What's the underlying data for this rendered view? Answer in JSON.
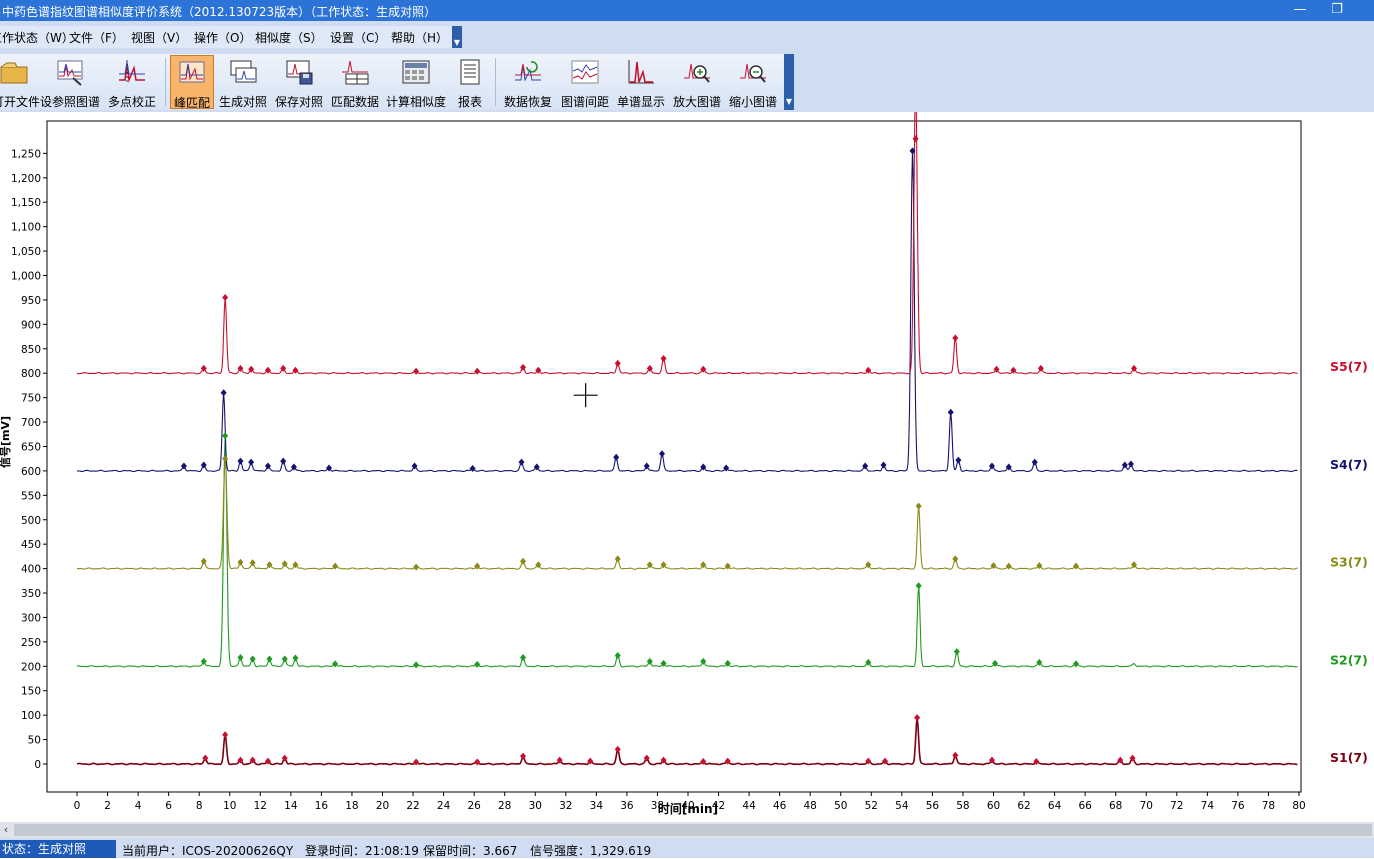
{
  "window": {
    "title": "中药色谱指纹图谱相似度评价系统（2012.130723版本）（工作状态：生成对照）"
  },
  "window_controls": {
    "minimize": "—",
    "restore": "❐"
  },
  "menu": [
    {
      "label": "工作状态（W）"
    },
    {
      "label": "文件（F）"
    },
    {
      "label": "视图（V）"
    },
    {
      "label": "操作（O）"
    },
    {
      "label": "相似度（S）"
    },
    {
      "label": "设置（C）"
    },
    {
      "label": "帮助（H）"
    }
  ],
  "toolbar": [
    {
      "label": "打开文件",
      "icon": "open-folder-icon"
    },
    {
      "label": "设参照图谱",
      "icon": "set-reference-icon"
    },
    {
      "label": "多点校正",
      "icon": "multipoint-correction-icon"
    },
    {
      "label": "峰匹配",
      "icon": "peak-match-icon",
      "active": true
    },
    {
      "label": "生成对照",
      "icon": "generate-reference-icon"
    },
    {
      "label": "保存对照",
      "icon": "save-reference-icon"
    },
    {
      "label": "匹配数据",
      "icon": "match-data-icon"
    },
    {
      "label": "计算相似度",
      "icon": "calculate-similarity-icon"
    },
    {
      "label": "报表",
      "icon": "report-icon"
    },
    {
      "label": "数据恢复",
      "icon": "data-restore-icon"
    },
    {
      "label": "图谱间距",
      "icon": "spectrum-spacing-icon"
    },
    {
      "label": "单谱显示",
      "icon": "single-spectrum-icon"
    },
    {
      "label": "放大图谱",
      "icon": "zoom-in-icon"
    },
    {
      "label": "缩小图谱",
      "icon": "zoom-out-icon"
    }
  ],
  "chart_data": {
    "type": "line",
    "xlabel": "时间[min]",
    "ylabel": "信号[mV]",
    "xlim": [
      0,
      80
    ],
    "ylim": [
      -15,
      1290
    ],
    "xticks": [
      0,
      2,
      4,
      6,
      8,
      10,
      12,
      14,
      16,
      18,
      20,
      22,
      24,
      26,
      28,
      30,
      32,
      34,
      36,
      38,
      40,
      42,
      44,
      46,
      48,
      50,
      52,
      54,
      56,
      58,
      60,
      62,
      64,
      66,
      68,
      70,
      72,
      74,
      76,
      78,
      80
    ],
    "yticks": [
      0,
      50,
      100,
      150,
      200,
      250,
      300,
      350,
      400,
      450,
      500,
      550,
      600,
      650,
      700,
      750,
      800,
      850,
      900,
      950,
      1000,
      1050,
      1100,
      1150,
      1200,
      1250
    ],
    "grid": false,
    "series": [
      {
        "name": "S1(7)",
        "color": "#7a0010",
        "marker_color": "#c8102e",
        "baseline": 0,
        "peaks": [
          [
            8.4,
            12
          ],
          [
            9.7,
            60
          ],
          [
            10.7,
            8
          ],
          [
            11.5,
            8
          ],
          [
            12.5,
            6
          ],
          [
            13.6,
            12
          ],
          [
            22.2,
            4
          ],
          [
            26.2,
            4
          ],
          [
            29.2,
            16
          ],
          [
            31.6,
            8
          ],
          [
            33.6,
            6
          ],
          [
            35.4,
            30
          ],
          [
            37.3,
            12
          ],
          [
            38.4,
            8
          ],
          [
            41.0,
            5
          ],
          [
            42.6,
            6
          ],
          [
            51.8,
            6
          ],
          [
            52.9,
            6
          ],
          [
            55.0,
            95
          ],
          [
            57.5,
            18
          ],
          [
            59.9,
            8
          ],
          [
            62.8,
            5
          ],
          [
            68.3,
            8
          ],
          [
            69.1,
            12
          ]
        ],
        "markers": [
          [
            8.4,
            12
          ],
          [
            9.7,
            60
          ],
          [
            10.7,
            8
          ],
          [
            11.5,
            8
          ],
          [
            12.5,
            6
          ],
          [
            13.6,
            12
          ],
          [
            22.2,
            4
          ],
          [
            26.2,
            4
          ],
          [
            29.2,
            16
          ],
          [
            31.6,
            8
          ],
          [
            33.6,
            6
          ],
          [
            35.4,
            30
          ],
          [
            37.3,
            12
          ],
          [
            38.4,
            8
          ],
          [
            41.0,
            5
          ],
          [
            42.6,
            6
          ],
          [
            51.8,
            6
          ],
          [
            52.9,
            6
          ],
          [
            55.0,
            95
          ],
          [
            57.5,
            18
          ],
          [
            59.9,
            8
          ],
          [
            62.8,
            5
          ],
          [
            68.3,
            8
          ],
          [
            69.1,
            12
          ]
        ]
      },
      {
        "name": "S2(7)",
        "color": "#1f9a1f",
        "marker_color": "#1f9a1f",
        "baseline": 200,
        "peaks": [
          [
            8.3,
            10
          ],
          [
            9.7,
            470
          ],
          [
            10.7,
            18
          ],
          [
            11.5,
            15
          ],
          [
            12.6,
            15
          ],
          [
            13.6,
            15
          ],
          [
            14.3,
            17
          ],
          [
            16.9,
            5
          ],
          [
            22.2,
            4
          ],
          [
            26.2,
            4
          ],
          [
            29.2,
            18
          ],
          [
            35.4,
            22
          ],
          [
            37.5,
            10
          ],
          [
            38.4,
            6
          ],
          [
            41.0,
            10
          ],
          [
            42.6,
            6
          ],
          [
            51.8,
            8
          ],
          [
            55.1,
            165
          ],
          [
            57.6,
            30
          ],
          [
            60.1,
            6
          ],
          [
            63.0,
            8
          ],
          [
            65.4,
            6
          ],
          [
            69.2,
            6
          ]
        ],
        "markers": [
          [
            8.3,
            210
          ],
          [
            9.7,
            672
          ],
          [
            10.7,
            218
          ],
          [
            11.5,
            215
          ],
          [
            12.6,
            215
          ],
          [
            13.6,
            215
          ],
          [
            14.3,
            217
          ],
          [
            16.9,
            205
          ],
          [
            22.2,
            203
          ],
          [
            26.2,
            204
          ],
          [
            29.2,
            218
          ],
          [
            35.4,
            222
          ],
          [
            37.5,
            210
          ],
          [
            38.4,
            206
          ],
          [
            41.0,
            210
          ],
          [
            42.6,
            206
          ],
          [
            51.8,
            208
          ],
          [
            55.1,
            365
          ],
          [
            57.6,
            230
          ],
          [
            60.1,
            206
          ],
          [
            63.0,
            208
          ],
          [
            65.4,
            205
          ]
        ]
      },
      {
        "name": "S3(7)",
        "color": "#8a8a1a",
        "marker_color": "#8a8a1a",
        "baseline": 400,
        "peaks": [
          [
            8.3,
            15
          ],
          [
            9.7,
            225
          ],
          [
            10.7,
            13
          ],
          [
            11.5,
            12
          ],
          [
            12.6,
            8
          ],
          [
            13.6,
            10
          ],
          [
            14.3,
            8
          ],
          [
            16.9,
            5
          ],
          [
            22.2,
            4
          ],
          [
            26.2,
            5
          ],
          [
            29.2,
            15
          ],
          [
            30.2,
            8
          ],
          [
            35.4,
            20
          ],
          [
            37.5,
            8
          ],
          [
            38.4,
            8
          ],
          [
            41.0,
            8
          ],
          [
            42.6,
            5
          ],
          [
            51.8,
            8
          ],
          [
            55.1,
            128
          ],
          [
            57.5,
            20
          ],
          [
            60.0,
            6
          ],
          [
            61.0,
            5
          ],
          [
            63.0,
            6
          ],
          [
            65.4,
            5
          ],
          [
            69.2,
            8
          ]
        ],
        "markers": [
          [
            8.3,
            415
          ],
          [
            9.7,
            625
          ],
          [
            10.7,
            413
          ],
          [
            11.5,
            412
          ],
          [
            12.6,
            408
          ],
          [
            13.6,
            410
          ],
          [
            14.3,
            408
          ],
          [
            16.9,
            405
          ],
          [
            22.2,
            403
          ],
          [
            26.2,
            405
          ],
          [
            29.2,
            415
          ],
          [
            30.2,
            408
          ],
          [
            35.4,
            420
          ],
          [
            37.5,
            408
          ],
          [
            38.4,
            408
          ],
          [
            41.0,
            408
          ],
          [
            42.6,
            405
          ],
          [
            51.8,
            408
          ],
          [
            55.1,
            528
          ],
          [
            57.5,
            420
          ],
          [
            60.0,
            406
          ],
          [
            61.0,
            405
          ],
          [
            63.0,
            406
          ],
          [
            65.4,
            405
          ],
          [
            69.2,
            408
          ]
        ]
      },
      {
        "name": "S4(7)",
        "color": "#14146e",
        "marker_color": "#14146e",
        "baseline": 600,
        "peaks": [
          [
            7.0,
            10
          ],
          [
            8.3,
            12
          ],
          [
            9.6,
            160
          ],
          [
            10.7,
            20
          ],
          [
            11.4,
            18
          ],
          [
            12.5,
            10
          ],
          [
            13.5,
            20
          ],
          [
            14.2,
            8
          ],
          [
            16.5,
            6
          ],
          [
            22.1,
            10
          ],
          [
            25.9,
            5
          ],
          [
            29.1,
            18
          ],
          [
            30.1,
            8
          ],
          [
            35.3,
            28
          ],
          [
            37.3,
            10
          ],
          [
            38.3,
            35
          ],
          [
            41.0,
            8
          ],
          [
            42.5,
            6
          ],
          [
            51.6,
            10
          ],
          [
            52.8,
            12
          ],
          [
            54.7,
            655
          ],
          [
            57.2,
            120
          ],
          [
            57.7,
            22
          ],
          [
            59.9,
            10
          ],
          [
            61.0,
            8
          ],
          [
            62.7,
            18
          ],
          [
            68.6,
            12
          ],
          [
            69.0,
            14
          ]
        ],
        "markers": [
          [
            7.0,
            610
          ],
          [
            8.3,
            612
          ],
          [
            9.6,
            760
          ],
          [
            10.7,
            620
          ],
          [
            11.4,
            618
          ],
          [
            12.5,
            610
          ],
          [
            13.5,
            620
          ],
          [
            14.2,
            608
          ],
          [
            16.5,
            606
          ],
          [
            22.1,
            610
          ],
          [
            25.9,
            605
          ],
          [
            29.1,
            618
          ],
          [
            30.1,
            608
          ],
          [
            35.3,
            628
          ],
          [
            37.3,
            610
          ],
          [
            38.3,
            635
          ],
          [
            41.0,
            608
          ],
          [
            42.5,
            606
          ],
          [
            51.6,
            610
          ],
          [
            52.8,
            612
          ],
          [
            54.7,
            1255
          ],
          [
            57.2,
            720
          ],
          [
            57.7,
            622
          ],
          [
            59.9,
            610
          ],
          [
            61.0,
            608
          ],
          [
            62.7,
            618
          ],
          [
            68.6,
            612
          ],
          [
            69.0,
            614
          ]
        ]
      },
      {
        "name": "S5(7)",
        "color": "#c8102e",
        "marker_color": "#c8102e",
        "baseline": 800,
        "peaks": [
          [
            8.3,
            10
          ],
          [
            9.7,
            155
          ],
          [
            10.7,
            10
          ],
          [
            11.4,
            8
          ],
          [
            12.5,
            6
          ],
          [
            13.5,
            10
          ],
          [
            14.3,
            6
          ],
          [
            22.2,
            4
          ],
          [
            26.2,
            4
          ],
          [
            29.2,
            12
          ],
          [
            30.2,
            6
          ],
          [
            35.4,
            20
          ],
          [
            37.5,
            10
          ],
          [
            38.4,
            30
          ],
          [
            41.0,
            8
          ],
          [
            51.8,
            6
          ],
          [
            54.9,
            585
          ],
          [
            57.5,
            72
          ],
          [
            60.2,
            8
          ],
          [
            61.3,
            6
          ],
          [
            63.1,
            10
          ],
          [
            69.2,
            10
          ]
        ],
        "markers": [
          [
            8.3,
            810
          ],
          [
            9.7,
            955
          ],
          [
            10.7,
            810
          ],
          [
            11.4,
            808
          ],
          [
            12.5,
            806
          ],
          [
            13.5,
            810
          ],
          [
            14.3,
            806
          ],
          [
            22.2,
            804
          ],
          [
            26.2,
            804
          ],
          [
            29.2,
            812
          ],
          [
            30.2,
            806
          ],
          [
            35.4,
            820
          ],
          [
            37.5,
            810
          ],
          [
            38.4,
            830
          ],
          [
            41.0,
            808
          ],
          [
            51.8,
            806
          ],
          [
            54.9,
            1280
          ],
          [
            57.5,
            872
          ],
          [
            60.2,
            808
          ],
          [
            61.3,
            806
          ],
          [
            63.1,
            810
          ],
          [
            69.2,
            810
          ]
        ]
      }
    ],
    "cursor": [
      33.3,
      755
    ]
  },
  "status": {
    "state": "状态：生成对照",
    "user": "当前用户：ICOS-20200626QY",
    "login_time": "登录时间：21:08:19",
    "retention_time": "保留时间：3.667",
    "signal": "信号强度：1,329.619"
  }
}
